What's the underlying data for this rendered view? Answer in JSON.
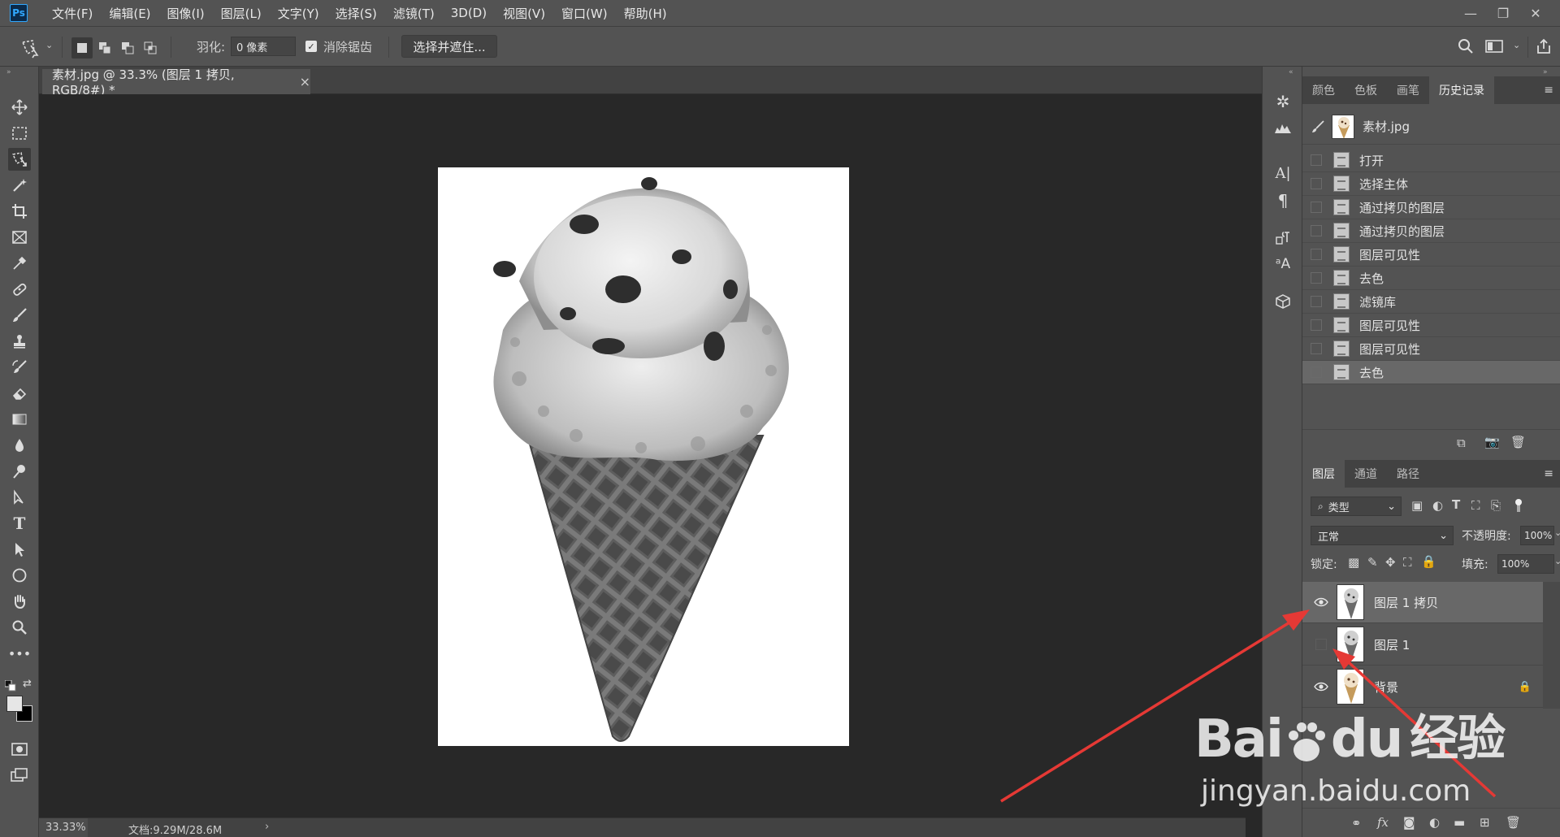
{
  "app": {
    "logo": "Ps"
  },
  "menu": [
    "文件(F)",
    "编辑(E)",
    "图像(I)",
    "图层(L)",
    "文字(Y)",
    "选择(S)",
    "滤镜(T)",
    "3D(D)",
    "视图(V)",
    "窗口(W)",
    "帮助(H)"
  ],
  "window_controls": {
    "minimize": "—",
    "restore": "❐",
    "close": "✕"
  },
  "options": {
    "feather_label": "羽化:",
    "feather_value": "0 像素",
    "antialias_label": "消除锯齿",
    "antialias_checked": true,
    "select_mask_button": "选择并遮住..."
  },
  "document": {
    "tab_title": "素材.jpg @ 33.3% (图层 1 拷贝, RGB/8#) *",
    "close": "×",
    "zoom": "33.33%",
    "doc_info": "文档:9.29M/28.6M",
    "status_arrow": "›"
  },
  "history_panel": {
    "tabs": [
      "颜色",
      "色板",
      "画笔",
      "历史记录"
    ],
    "active_tab": "历史记录",
    "snapshot": "素材.jpg",
    "items": [
      "打开",
      "选择主体",
      "通过拷贝的图层",
      "通过拷贝的图层",
      "图层可见性",
      "去色",
      "滤镜库",
      "图层可见性",
      "图层可见性",
      "去色"
    ],
    "selected_index": 9
  },
  "layers_panel": {
    "tabs": [
      "图层",
      "通道",
      "路径"
    ],
    "active_tab": "图层",
    "filter_kind": "类型",
    "blend_mode": "正常",
    "opacity_label": "不透明度:",
    "opacity": "100%",
    "lock_label": "锁定:",
    "fill_label": "填充:",
    "fill": "100%",
    "layers": [
      {
        "name": "图层 1 拷贝",
        "visible": true,
        "selected": true
      },
      {
        "name": "图层 1",
        "visible": false,
        "selected": false
      },
      {
        "name": "背景",
        "visible": true,
        "selected": false,
        "locked": true
      }
    ],
    "footer_fx": "fx"
  },
  "watermark": {
    "brand": "Bai",
    "brand2": "du",
    "suffix": "经验",
    "url": "jingyan.baidu.com"
  },
  "colors": {
    "accent": "#31a8ff",
    "panel": "#535353",
    "canvas": "#282828",
    "arrow": "#e53935"
  }
}
